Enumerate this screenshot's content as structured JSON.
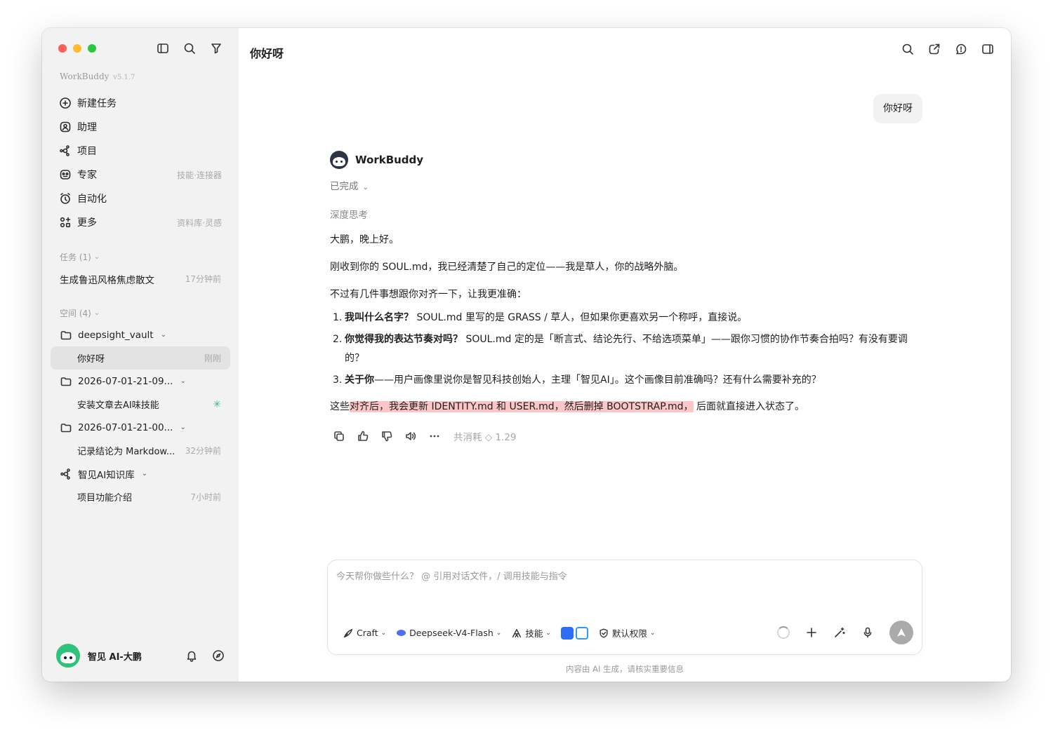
{
  "sidebar": {
    "brand": "WorkBuddy",
    "version": "v5.1.7",
    "nav": [
      {
        "label": "新建任务",
        "icon": "plus-circle-icon",
        "hint": ""
      },
      {
        "label": "助理",
        "icon": "assistant-icon",
        "hint": ""
      },
      {
        "label": "项目",
        "icon": "project-icon",
        "hint": ""
      },
      {
        "label": "专家",
        "icon": "expert-icon",
        "hint": "技能·连接器"
      },
      {
        "label": "自动化",
        "icon": "automation-icon",
        "hint": ""
      },
      {
        "label": "更多",
        "icon": "more-grid-icon",
        "hint": "资料库·灵感"
      }
    ],
    "tasks": {
      "title": "任务 (1)",
      "items": [
        {
          "label": "生成鲁迅风格焦虑散文",
          "time": "17分钟前"
        }
      ]
    },
    "spaces": {
      "title": "空间 (4)",
      "groups": [
        {
          "name": "deepsight_vault",
          "items": [
            {
              "label": "你好呀",
              "time": "刚刚"
            }
          ]
        },
        {
          "name": "2026-07-01-21-09...",
          "items": [
            {
              "label": "安装文章去AI味技能",
              "time": ""
            }
          ]
        },
        {
          "name": "2026-07-01-21-00...",
          "items": [
            {
              "label": "记录结论为 Markdow...",
              "time": "32分钟前"
            }
          ]
        },
        {
          "name": "智见AI知识库",
          "items": [
            {
              "label": "项目功能介绍",
              "time": "7小时前"
            }
          ]
        }
      ]
    },
    "user": {
      "name": "智见 AI-大鹏"
    }
  },
  "main": {
    "title": "你好呀",
    "user_message": "你好呀",
    "bot": {
      "name": "WorkBuddy",
      "status": "已完成",
      "thinking": "深度思考",
      "greeting": "大鹏，晚上好。",
      "para1": "刚收到你的 SOUL.md，我已经清楚了自己的定位——我是草人，你的战略外脑。",
      "para2": "不过有几件事想跟你对齐一下，让我更准确：",
      "list": [
        {
          "num": "1.",
          "bold": "我叫什么名字？",
          "text": " SOUL.md 里写的是 GRASS / 草人，但如果你更喜欢另一个称呼，直接说。"
        },
        {
          "num": "2.",
          "bold": "你觉得我的表达节奏对吗？",
          "text": " SOUL.md 定的是「断言式、结论先行、不给选项菜单」——跟你习惯的协作节奏合拍吗？有没有要调的？"
        },
        {
          "num": "3.",
          "bold": "关于你",
          "text": "——用户画像里说你是智见科技创始人，主理「智见AI」。这个画像目前准确吗？还有什么需要补充的？"
        }
      ],
      "closing_pre": "这些",
      "closing_highlight": "对齐后，我会更新 IDENTITY.md 和 USER.md，然后删掉 BOOTSTRAP.md，",
      "closing_post": " 后面就直接进入状态了。",
      "cost_label": "共消耗 ◇ 1.29"
    },
    "composer": {
      "placeholder": "今天帮你做些什么？ @ 引用对话文件，/ 调用技能与指令",
      "mode": "Craft",
      "model": "Deepseek-V4-Flash",
      "skills": "技能",
      "permission": "默认权限"
    },
    "disclaimer": "内容由 AI 生成，请核实重要信息"
  }
}
